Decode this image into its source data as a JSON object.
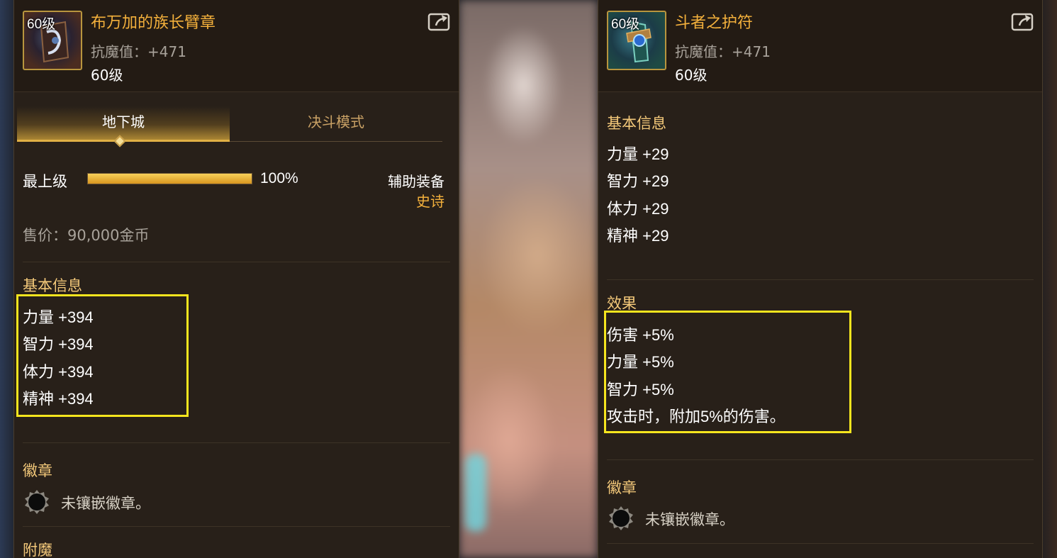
{
  "left": {
    "level_badge": "60级",
    "name": "布万加的族长臂章",
    "resist": "抗魔值：+471",
    "level": "60级",
    "icon": "external-link-icon",
    "tabs": [
      "地下城",
      "决斗模式"
    ],
    "grade": {
      "label": "最上级",
      "percent_text": "100%",
      "percent": 100
    },
    "slot_type": "辅助装备",
    "rarity": "史诗",
    "price": "售价：90,000金币",
    "basic_title": "基本信息",
    "stats": [
      "力量 +394",
      "智力 +394",
      "体力 +394",
      "精神 +394"
    ],
    "emblem_title": "徽章",
    "emblem_text": "未镶嵌徽章。",
    "enchant_title": "附魔"
  },
  "right": {
    "level_badge": "60级",
    "name": "斗者之护符",
    "resist": "抗魔值：+471",
    "level": "60级",
    "icon": "external-link-icon",
    "basic_title": "基本信息",
    "stats": [
      "力量 +29",
      "智力 +29",
      "体力 +29",
      "精神 +29"
    ],
    "effect_title": "效果",
    "effects": [
      "伤害 +5%",
      "力量 +5%",
      "智力 +5%",
      "攻击时，附加5%的伤害。"
    ],
    "emblem_title": "徽章",
    "emblem_text": "未镶嵌徽章。"
  },
  "colors": {
    "highlight": "#f5e51e",
    "title": "#f4b13c",
    "section": "#f4c97a",
    "panel": "#282019"
  }
}
